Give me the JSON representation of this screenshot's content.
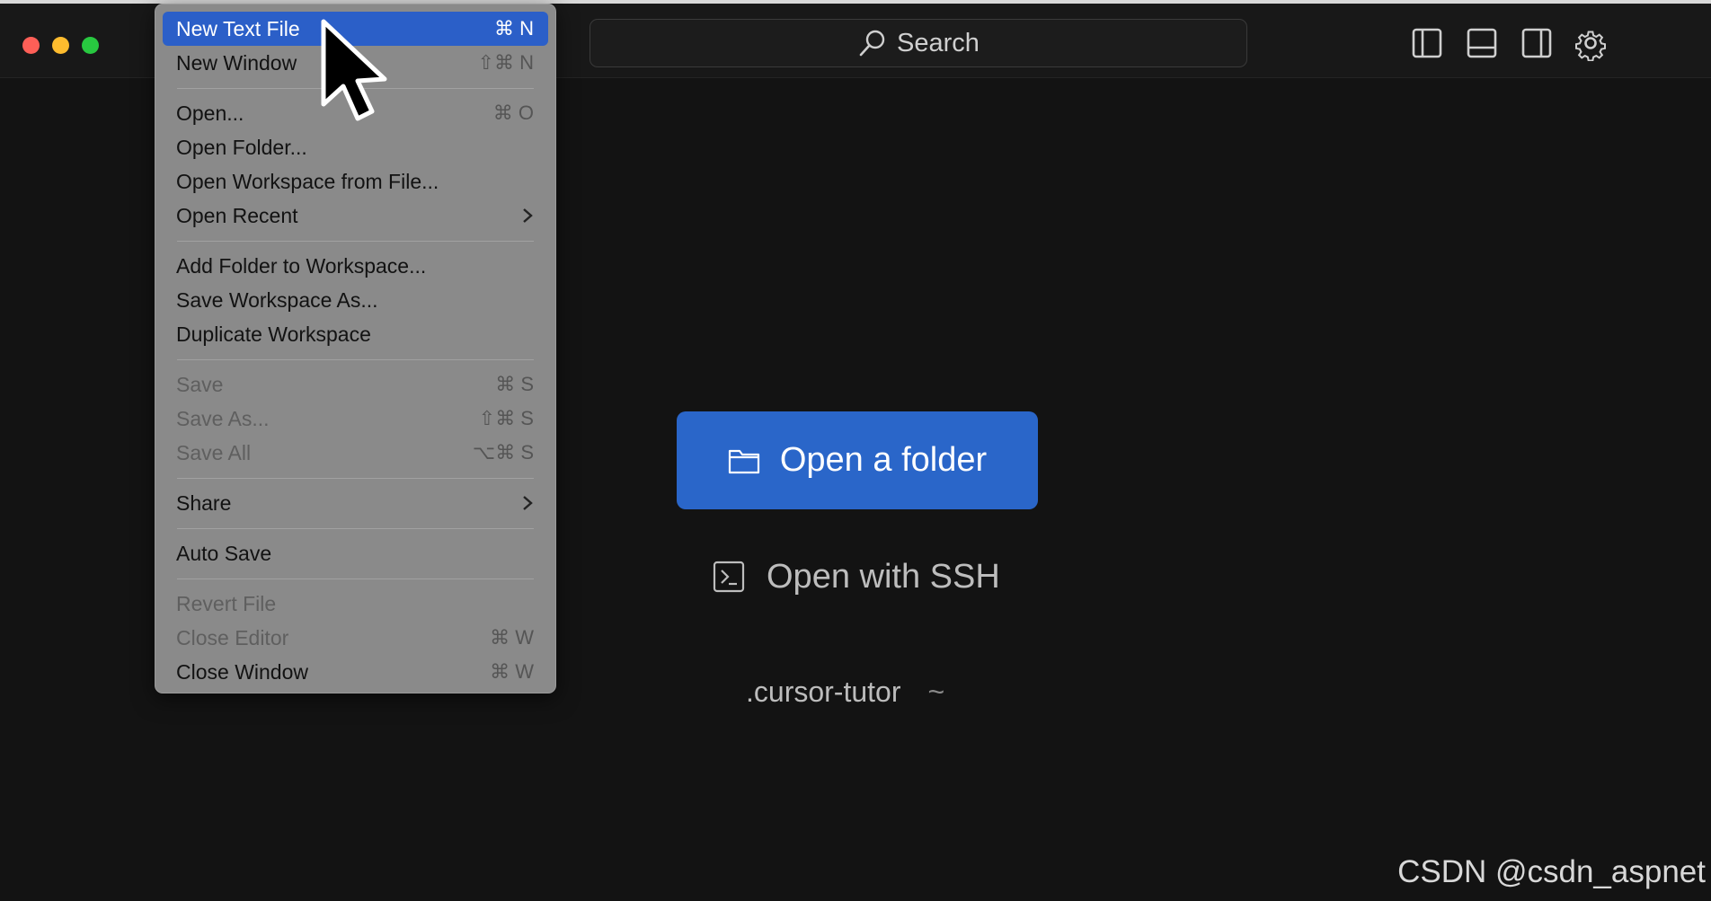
{
  "titlebar": {
    "search_label": "Search"
  },
  "menu": {
    "items": [
      {
        "label": "New Text File",
        "shortcut": "⌘ N",
        "state": "selected"
      },
      {
        "label": "New Window",
        "shortcut": "⇧⌘ N",
        "state": "normal"
      },
      {
        "label": "Open...",
        "shortcut": "⌘ O",
        "state": "normal"
      },
      {
        "label": "Open Folder...",
        "shortcut": "",
        "state": "normal"
      },
      {
        "label": "Open Workspace from File...",
        "shortcut": "",
        "state": "normal"
      },
      {
        "label": "Open Recent",
        "shortcut": "",
        "state": "normal"
      },
      {
        "label": "Add Folder to Workspace...",
        "shortcut": "",
        "state": "normal"
      },
      {
        "label": "Save Workspace As...",
        "shortcut": "",
        "state": "normal"
      },
      {
        "label": "Duplicate Workspace",
        "shortcut": "",
        "state": "normal"
      },
      {
        "label": "Save",
        "shortcut": "⌘ S",
        "state": "disabled"
      },
      {
        "label": "Save As...",
        "shortcut": "⇧⌘ S",
        "state": "disabled"
      },
      {
        "label": "Save All",
        "shortcut": "⌥⌘ S",
        "state": "disabled"
      },
      {
        "label": "Share",
        "shortcut": "",
        "state": "normal"
      },
      {
        "label": "Auto Save",
        "shortcut": "",
        "state": "normal"
      },
      {
        "label": "Revert File",
        "shortcut": "",
        "state": "disabled"
      },
      {
        "label": "Close Editor",
        "shortcut": "⌘ W",
        "state": "disabled"
      },
      {
        "label": "Close Window",
        "shortcut": "⌘ W",
        "state": "normal"
      }
    ]
  },
  "welcome": {
    "open_folder_label": "Open a folder",
    "open_ssh_label": "Open with SSH",
    "recent_name": ".cursor-tutor",
    "recent_path": "~"
  },
  "watermark": "CSDN @csdn_aspnet",
  "icons": {
    "folder": "folder-icon",
    "terminal": "terminal-icon",
    "search": "search-icon",
    "settings": "gear-icon"
  },
  "colors": {
    "accent": "#2a66c9",
    "menu_highlight": "#2b5fc8",
    "traffic_close": "#fe5f57",
    "traffic_minimize": "#febc2e",
    "traffic_maximize": "#28c840"
  }
}
